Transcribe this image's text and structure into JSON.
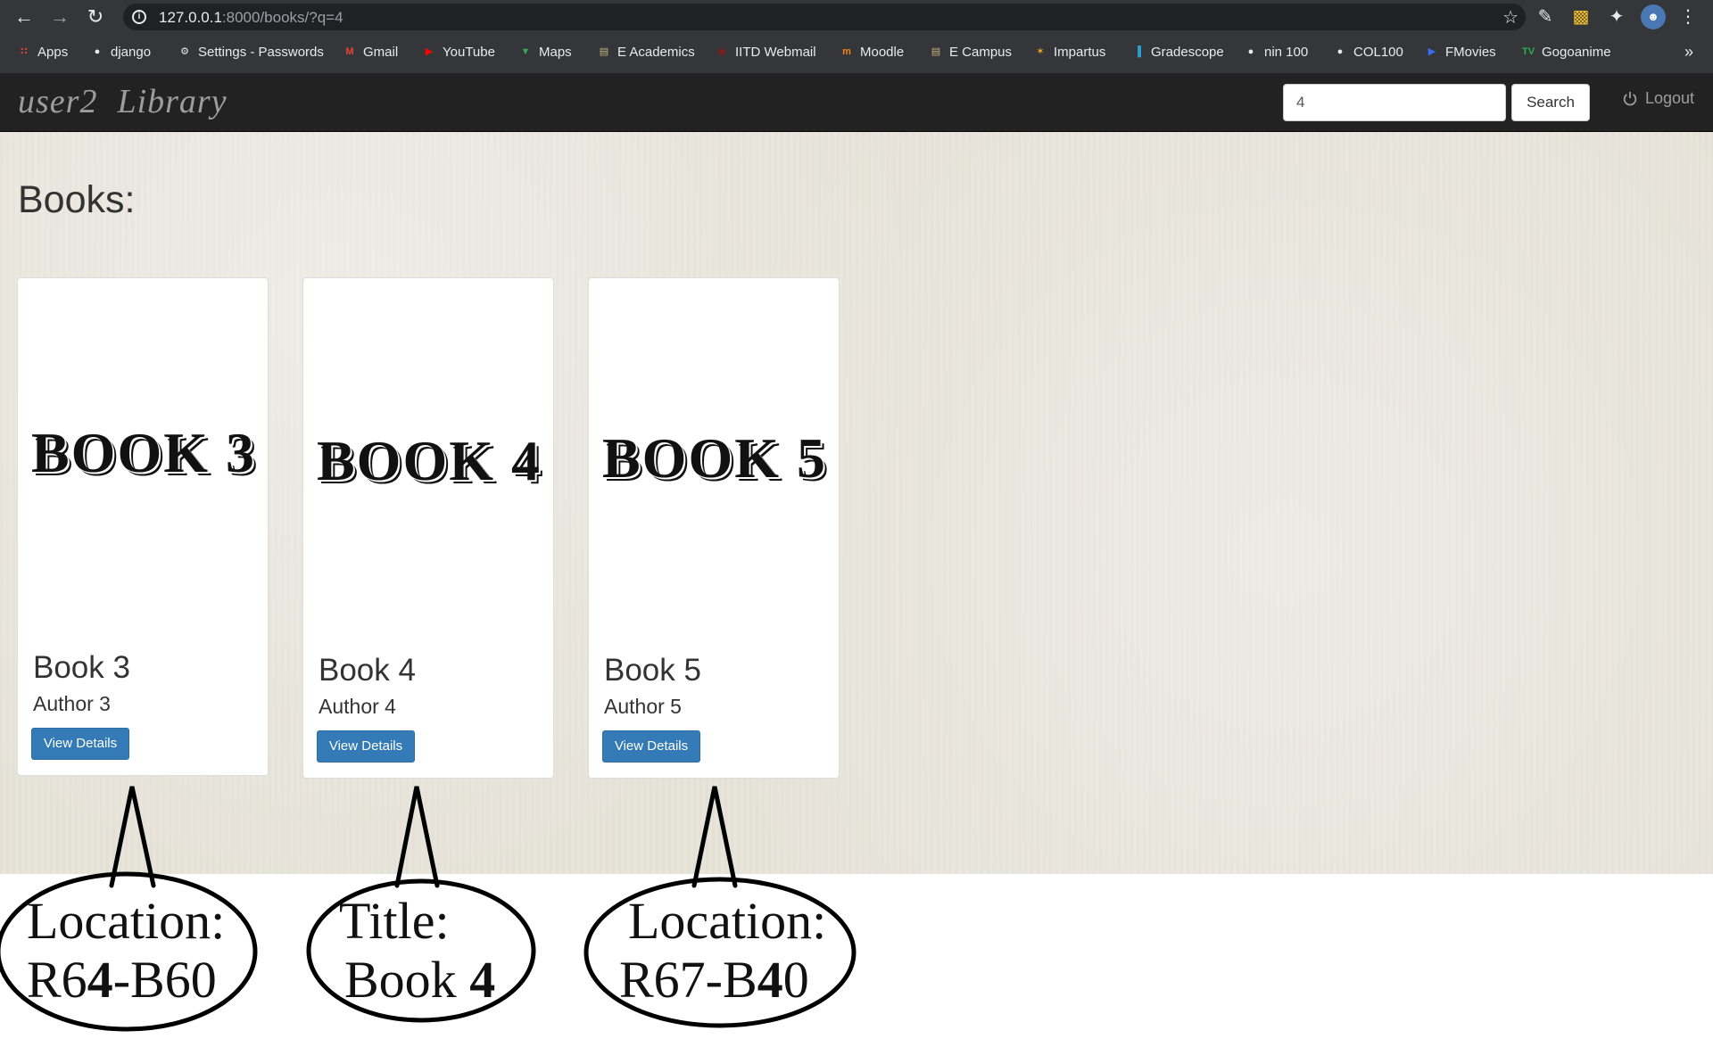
{
  "browser": {
    "url_host": "127.0.0.1",
    "url_path": ":8000/books/?q=4",
    "bookmarks": [
      {
        "label": "Apps",
        "icon": "apps-grid-icon",
        "color": "#ea4335"
      },
      {
        "label": "django",
        "icon": "globe-icon",
        "color": "#e8eaed"
      },
      {
        "label": "Settings - Passwords",
        "icon": "gear-icon",
        "color": "#e8eaed"
      },
      {
        "label": "Gmail",
        "icon": "gmail-icon",
        "color": "#ea4335"
      },
      {
        "label": "YouTube",
        "icon": "youtube-icon",
        "color": "#ff0000"
      },
      {
        "label": "Maps",
        "icon": "maps-pin-icon",
        "color": "#34a853"
      },
      {
        "label": "E Academics",
        "icon": "document-icon",
        "color": "#c9b27c"
      },
      {
        "label": "IITD Webmail",
        "icon": "webmail-icon",
        "color": "#8b1a1a"
      },
      {
        "label": "Moodle",
        "icon": "moodle-icon",
        "color": "#f98012"
      },
      {
        "label": "E Campus",
        "icon": "document-icon",
        "color": "#c9b27c"
      },
      {
        "label": "Impartus",
        "icon": "impartus-icon",
        "color": "#f5a623"
      },
      {
        "label": "Gradescope",
        "icon": "bar-chart-icon",
        "color": "#28a0d0"
      },
      {
        "label": "nin 100",
        "icon": "globe-icon",
        "color": "#e8eaed"
      },
      {
        "label": "COL100",
        "icon": "globe-icon",
        "color": "#e8eaed"
      },
      {
        "label": "FMovies",
        "icon": "play-circle-icon",
        "color": "#3b6cf5"
      },
      {
        "label": "Gogoanime",
        "icon": "tv-icon",
        "color": "#2db14a"
      }
    ],
    "more_label": "»"
  },
  "app": {
    "brand_user": "user2",
    "brand_name": "Library",
    "search_value": "4",
    "search_button": "Search",
    "logout_label": "Logout"
  },
  "page": {
    "heading": "Books:"
  },
  "books": [
    {
      "cover_text": "BOOK 3",
      "title": "Book 3",
      "author": "Author 3",
      "button": "View Details"
    },
    {
      "cover_text": "BOOK 4",
      "title": "Book 4",
      "author": "Author 4",
      "button": "View Details"
    },
    {
      "cover_text": "BOOK 5",
      "title": "Book 5",
      "author": "Author 5",
      "button": "View Details"
    }
  ],
  "annotations": [
    {
      "line1": "Location:",
      "line2_pre": "R6",
      "line2_bold": "4",
      "line2_post": "-B60"
    },
    {
      "line1": "Title:",
      "line2_pre": "Book ",
      "line2_bold": "4",
      "line2_post": ""
    },
    {
      "line1": "Location:",
      "line2_pre": "R67-B",
      "line2_bold": "4",
      "line2_post": "0"
    }
  ]
}
